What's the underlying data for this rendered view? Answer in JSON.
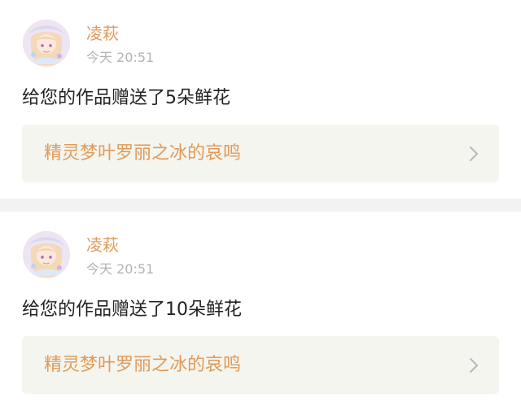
{
  "notifications": [
    {
      "username": "凌萩",
      "time": "今天 20:51",
      "message": "给您的作品赠送了5朵鲜花",
      "work_title": "精灵梦叶罗丽之冰的哀鸣",
      "avatar_icon": "anime-girl-avatar",
      "chevron_icon": "chevron-right-icon"
    },
    {
      "username": "凌萩",
      "time": "今天 20:51",
      "message": "给您的作品赠送了10朵鲜花",
      "work_title": "精灵梦叶罗丽之冰的哀鸣",
      "avatar_icon": "anime-girl-avatar",
      "chevron_icon": "chevron-right-icon"
    }
  ],
  "colors": {
    "accent": "#e09a5a",
    "card_background": "#f4f5ef",
    "divider": "#f2f2f2",
    "muted_text": "#b3b3b3",
    "body_text": "#222222"
  }
}
